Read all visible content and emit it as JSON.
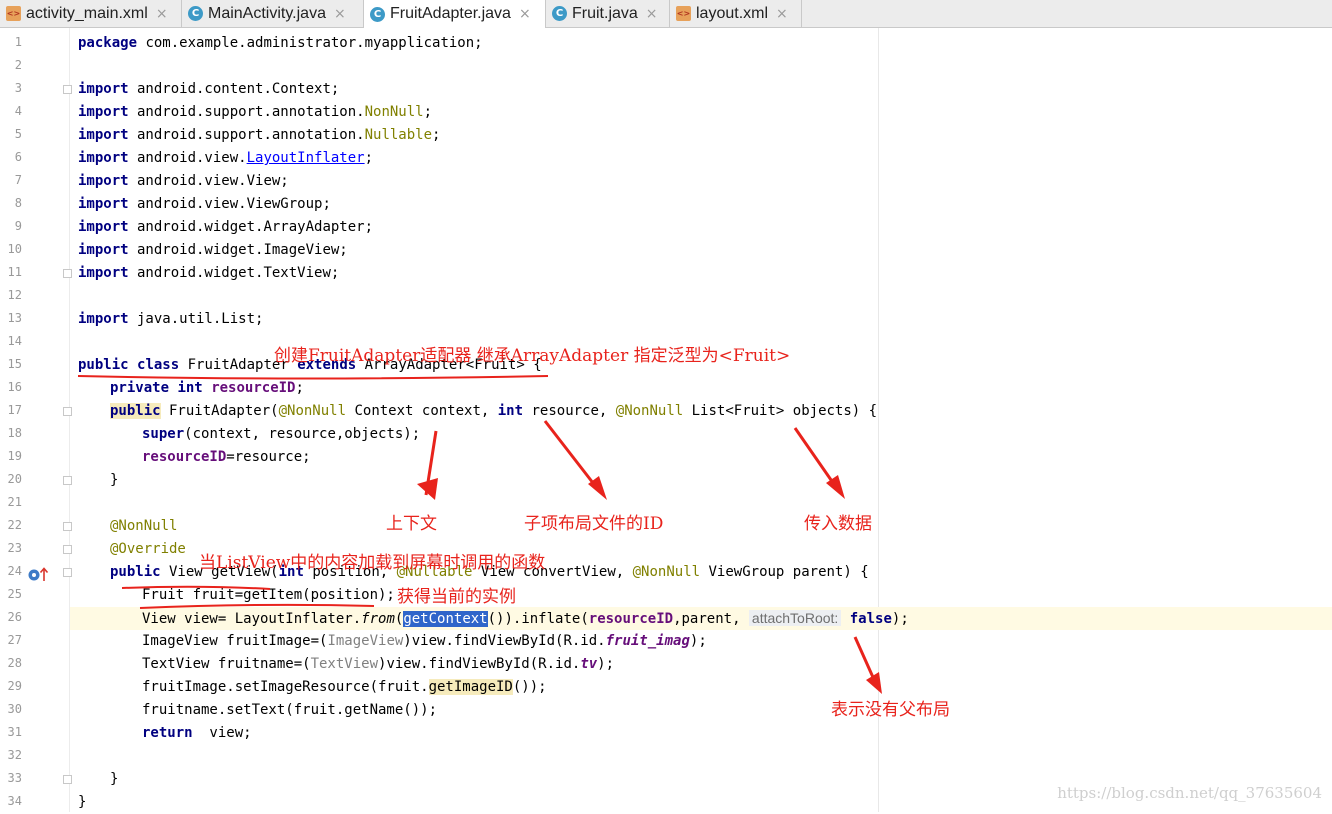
{
  "tabs": [
    {
      "label": "activity_main.xml",
      "type": "xml",
      "active": false
    },
    {
      "label": "MainActivity.java",
      "type": "java",
      "active": false
    },
    {
      "label": "FruitAdapter.java",
      "type": "java",
      "active": true
    },
    {
      "label": "Fruit.java",
      "type": "java",
      "active": false
    },
    {
      "label": "layout.xml",
      "type": "xml",
      "active": false
    }
  ],
  "tab_close_glyph": "×",
  "line_numbers": [
    "1",
    "2",
    "3",
    "4",
    "5",
    "6",
    "7",
    "8",
    "9",
    "10",
    "11",
    "12",
    "13",
    "14",
    "15",
    "16",
    "17",
    "18",
    "19",
    "20",
    "21",
    "22",
    "23",
    "24",
    "25",
    "26",
    "27",
    "28",
    "29",
    "30",
    "31",
    "32",
    "33",
    "34"
  ],
  "code": {
    "l1_kw": "package",
    "l1_rest": " com.example.administrator.myapplication;",
    "import_kw": "import",
    "l3": " android.content.Context;",
    "l4_a": " android.support.annotation.",
    "l4_b": "NonNull",
    "l4_c": ";",
    "l5_a": " android.support.annotation.",
    "l5_b": "Nullable",
    "l5_c": ";",
    "l6_a": " android.view.",
    "l6_b": "LayoutInflater",
    "l6_c": ";",
    "l7": " android.view.View;",
    "l8": " android.view.ViewGroup;",
    "l9": " android.widget.ArrayAdapter;",
    "l10": " android.widget.ImageView;",
    "l11": " android.widget.TextView;",
    "l13": " java.util.List;",
    "l15_public": "public",
    "l15_class": "class",
    "l15_name": " FruitAdapter ",
    "l15_extends": "extends",
    "l15_rest": " ArrayAdapter<Fruit> {",
    "l16_private": "private",
    "l16_int": "int",
    "l16_field": "resourceID",
    "l16_end": ";",
    "l17_public": "public",
    "l17_a": " FruitAdapter(",
    "l17_ann1": "@NonNull",
    "l17_b": " Context context, ",
    "l17_int": "int",
    "l17_c": " resource, ",
    "l17_ann2": "@NonNull",
    "l17_d": " List<Fruit> objects) {",
    "l18_super": "super",
    "l18_rest": "(context, resource,objects);",
    "l19_field": "resourceID",
    "l19_rest": "=resource;",
    "l20": "}",
    "l22": "@NonNull",
    "l23": "@Override",
    "l24_public": "public",
    "l24_a": " View getView(",
    "l24_int": "int",
    "l24_b": " position, ",
    "l24_ann1": "@Nullable",
    "l24_c": " View convertView, ",
    "l24_ann2": "@NonNull",
    "l24_d": " ViewGroup parent) {",
    "l25": "Fruit fruit=getItem(position);",
    "l26_a": "View view= LayoutInflater.",
    "l26_from": "from",
    "l26_b": "(",
    "l26_sel": "getContext",
    "l26_c": "()).inflate(",
    "l26_field": "resourceID",
    "l26_d": ",parent, ",
    "l26_hint": "attachToRoot:",
    "l26_false": "false",
    "l26_e": ");",
    "l27_a": "ImageView fruitImage=(",
    "l27_gray": "ImageView",
    "l27_b": ")view.findViewById(R.id.",
    "l27_field": "fruit_imag",
    "l27_c": ");",
    "l28_a": "TextView fruitname=(",
    "l28_gray": "TextView",
    "l28_b": ")view.findViewById(R.id.",
    "l28_field": "tv",
    "l28_c": ");",
    "l29_a": "fruitImage.setImageResource(fruit.",
    "l29_hl": "getImageID",
    "l29_b": "());",
    "l30": "fruitname.setText(fruit.getName());",
    "l31_kw": "return",
    "l31_rest": "  view;",
    "l33": "}",
    "l34": "}"
  },
  "annotations": {
    "class_note": "创建FruitAdapter适配器 继承ArrayAdapter  指定泛型为<Fruit>",
    "context_note": "上下文",
    "resource_note": "子项布局文件的ID",
    "objects_note": "传入数据",
    "getview_note": "当ListView中的内容加载到屏幕时调用的函数",
    "getitem_note": "获得当前的实例",
    "false_note": "表示没有父布局"
  },
  "watermark": "https://blog.csdn.net/qq_37635604",
  "colors": {
    "annotation_red": "#e8231c",
    "keyword": "#000080",
    "annotation_code": "#808000",
    "field": "#660e7a",
    "selection": "#2f65ca"
  }
}
